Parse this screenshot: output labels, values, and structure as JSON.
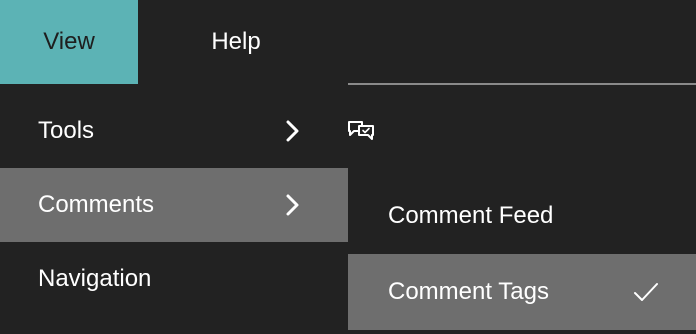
{
  "menubar": {
    "view_label": "View",
    "help_label": "Help"
  },
  "view_menu": {
    "items": [
      {
        "label": "Tools",
        "has_submenu": true
      },
      {
        "label": "Comments",
        "has_submenu": true,
        "highlighted": true
      },
      {
        "label": "Navigation",
        "has_submenu": false
      }
    ]
  },
  "comments_submenu": {
    "icon": "comments-icon",
    "items": [
      {
        "label": "Comment Feed",
        "checked": false
      },
      {
        "label": "Comment Tags",
        "checked": true
      }
    ]
  },
  "colors": {
    "background": "#222222",
    "active_menu": "#5cb3b5",
    "highlight": "#6e6e6e",
    "text": "#ffffff"
  }
}
